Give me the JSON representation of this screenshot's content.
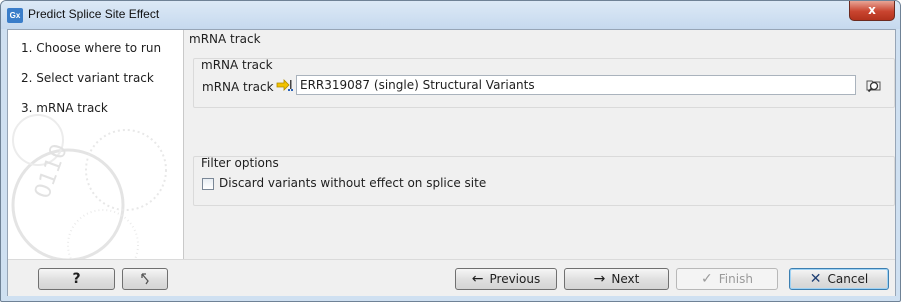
{
  "window": {
    "title": "Predict Splice Site Effect",
    "app_icon_text": "Gx",
    "close_label": "x"
  },
  "steps": [
    {
      "number": "1.",
      "label": "Choose where to run"
    },
    {
      "number": "2.",
      "label": "Select variant track"
    },
    {
      "number": "3.",
      "label": "mRNA track"
    }
  ],
  "main": {
    "section_label": "mRNA track",
    "mrna_group": {
      "title": "mRNA track",
      "field_label": "mRNA track",
      "value": "ERR319087 (single) Structural Variants"
    },
    "filter_group": {
      "title": "Filter options",
      "checkbox_label": "Discard variants without effect on splice site",
      "checked": false
    }
  },
  "buttons": {
    "help": "?",
    "previous": "Previous",
    "next": "Next",
    "finish": "Finish",
    "cancel": "Cancel"
  },
  "icons": {
    "help": "question-mark",
    "reset": "undo-arrow",
    "previous": "arrow-left",
    "next": "arrow-right",
    "finish": "checkmark",
    "cancel": "x-mark"
  }
}
